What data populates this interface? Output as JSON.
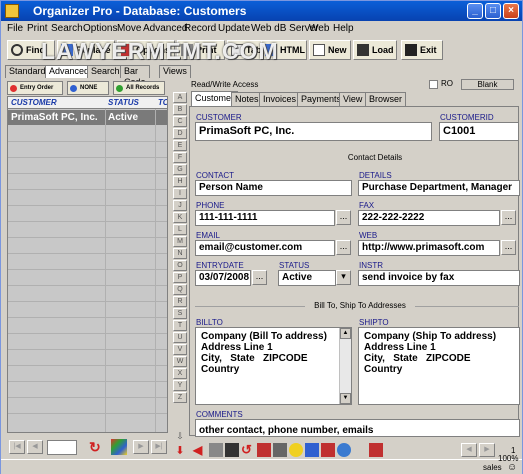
{
  "window": {
    "title": "Organizer Pro - Database: Customers"
  },
  "watermark": "LAWYERMEMT.COM",
  "menu": [
    "File",
    "Print",
    "Search",
    "Options",
    "Move",
    "Advanced",
    "Record",
    "Update",
    "Web dB Server",
    "Web",
    "Help"
  ],
  "toolbar": {
    "find": "Find",
    "replace": "Replace",
    "options": "Options",
    "print": "Print",
    "table": "Table",
    "html": "HTML",
    "new": "New",
    "load": "Load",
    "exit": "Exit"
  },
  "left_tabs": [
    "Standard",
    "Advanced",
    "Search",
    "Bar Code",
    "Views"
  ],
  "left_tools": {
    "entry_order": "Entry Order",
    "none": "NONE",
    "all_records": "All Records"
  },
  "grid": {
    "columns": [
      "CUSTOMER",
      "STATUS",
      "TO"
    ],
    "rows": [
      {
        "customer": "PrimaSoft PC, Inc.",
        "status": "Active"
      }
    ]
  },
  "alphabet": [
    "A",
    "B",
    "C",
    "D",
    "E",
    "F",
    "G",
    "H",
    "I",
    "J",
    "K",
    "L",
    "M",
    "N",
    "O",
    "P",
    "Q",
    "R",
    "S",
    "T",
    "U",
    "V",
    "W",
    "X",
    "Y",
    "Z"
  ],
  "form_header": {
    "access": "Read/Write Access",
    "ro_label": "RO",
    "blank_label": "Blank"
  },
  "form_tabs": [
    "Customer",
    "Notes",
    "Invoices",
    "Payments",
    "View",
    "Browser"
  ],
  "form": {
    "customer_label": "CUSTOMER",
    "customer_value": "PrimaSoft PC, Inc.",
    "customerid_label": "CUSTOMERID",
    "customerid_value": "C1001",
    "contact_details": "Contact Details",
    "contact_label": "CONTACT",
    "contact_value": "Person Name",
    "details_label": "DETAILS",
    "details_value": "Purchase Department, Manager",
    "phone_label": "PHONE",
    "phone_value": "111-111-1111",
    "fax_label": "FAX",
    "fax_value": "222-222-2222",
    "email_label": "EMAIL",
    "email_value": "email@customer.com",
    "web_label": "WEB",
    "web_value": "http://www.primasoft.com",
    "entrydate_label": "ENTRYDATE",
    "entrydate_value": "03/07/2008",
    "status_label": "STATUS",
    "status_value": "Active",
    "instr_label": "INSTR",
    "instr_value": "send invoice by fax",
    "billship": "Bill To, Ship To Addresses",
    "billto_label": "BILLTO",
    "billto_value": "Company (Bill To address)\nAddress Line 1\nCity,   State   ZIPCODE\nCountry",
    "shipto_label": "SHIPTO",
    "shipto_value": "Company (Ship To address)\nAddress Line 1\nCity,   State   ZIPCODE\nCountry",
    "comments_label": "COMMENTS",
    "comments_value": "other contact, phone number, emails"
  },
  "status": {
    "record": "1",
    "zoom": "100%",
    "db": "sales"
  },
  "colors": {
    "title_bar": "#0842b0",
    "accent_label": "#1a3aa8",
    "grid_select": "#7a7a7a"
  }
}
